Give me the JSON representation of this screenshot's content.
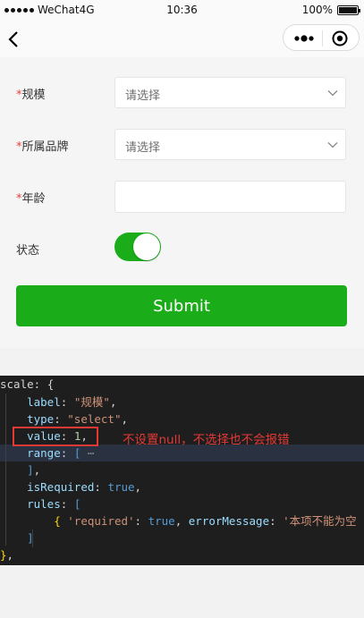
{
  "status_bar": {
    "carrier": "WeChat4G",
    "time": "10:36",
    "battery": "100%"
  },
  "nav": {
    "back_icon": "back-arrow-icon",
    "more_icon": "more-dots-icon",
    "close_icon": "target-circle-icon"
  },
  "form": {
    "fields": [
      {
        "label": "规模",
        "required_mark": "*",
        "placeholder": "请选择"
      },
      {
        "label": "所属品牌",
        "required_mark": "*",
        "placeholder": "请选择"
      },
      {
        "label": "年龄",
        "required_mark": "*",
        "value": ""
      }
    ],
    "status_label": "状态",
    "status_on": true,
    "submit_label": "Submit",
    "colors": {
      "primary": "#1aad19",
      "required": "#e64340"
    }
  },
  "code": {
    "line1_key": "scale",
    "line1_rest": ": {",
    "label_key": "label",
    "label_val": "\"规模\"",
    "type_key": "type",
    "type_val": "\"select\"",
    "value_key": "value",
    "value_num": "1",
    "range_key": "range",
    "range_fold": "⋯",
    "required_key": "isRequired",
    "required_val": "true",
    "rules_key": "rules",
    "rule_key1": "'required'",
    "rule_val1": "true",
    "rule_key2": "errorMessage",
    "rule_msg": "'本项不能为空"
  },
  "annotation": "不设置null，不选择也不会报错"
}
